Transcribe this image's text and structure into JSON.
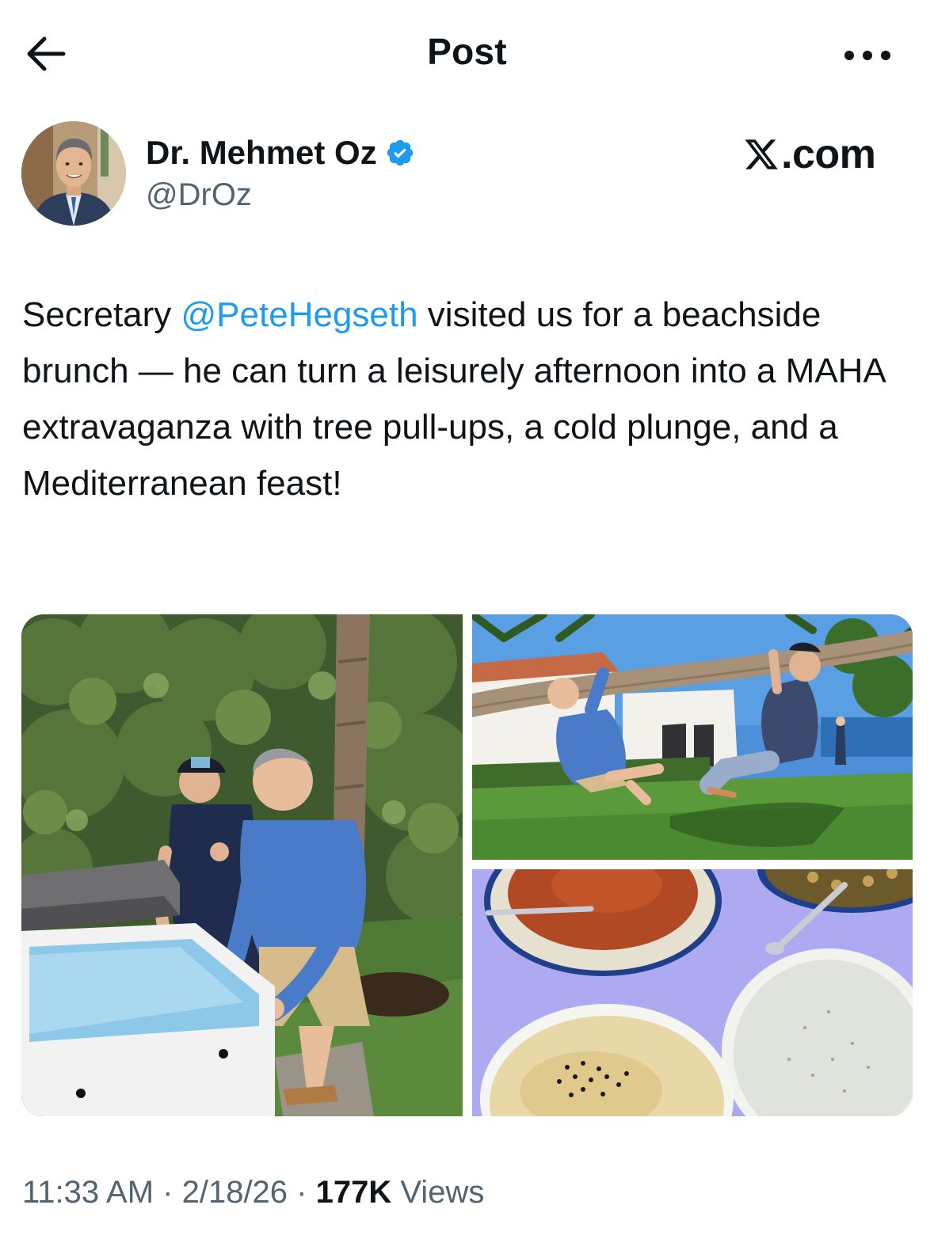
{
  "header": {
    "title": "Post"
  },
  "author": {
    "name": "Dr. Mehmet Oz",
    "handle": "@DrOz",
    "verified": true,
    "verified_color": "#1d9bf0"
  },
  "watermark": {
    "text": ".com"
  },
  "post": {
    "text_before": "Secretary ",
    "mention": "@PeteHegseth",
    "text_after": " visited us for a beachside brunch — he can turn a leisurely afternoon into a MAHA extravaganza with tree pull-ups, a cold plunge, and a Mediterranean feast!",
    "mention_color": "#1d9bf0"
  },
  "media": {
    "count": 3
  },
  "meta": {
    "time": "11:33 AM",
    "sep1": " · ",
    "date": "2/18/26",
    "sep2": " · ",
    "views_count": "177K",
    "views_label": " Views"
  },
  "icons": {
    "back": "arrow-left-icon",
    "more": "more-horizontal-icon",
    "verified": "verified-badge-icon",
    "x_logo": "x-logo-icon"
  }
}
